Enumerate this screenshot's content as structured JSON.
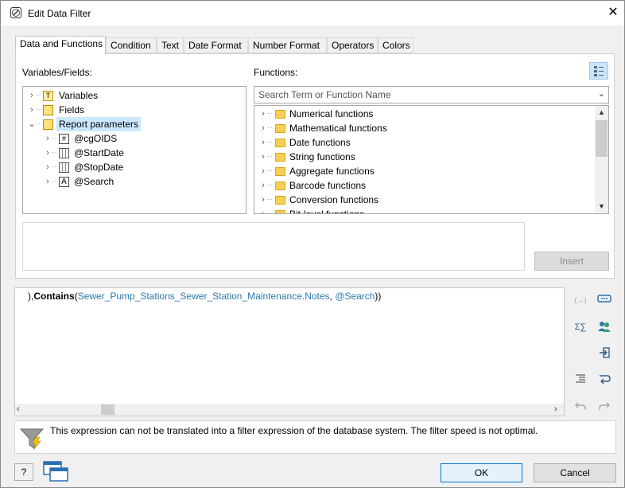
{
  "window": {
    "title": "Edit Data Filter",
    "close_glyph": "✕"
  },
  "tabs": [
    "Data and Functions",
    "Condition",
    "Text",
    "Date Format",
    "Number Format",
    "Operators",
    "Colors"
  ],
  "active_tab": "Data and Functions",
  "variables_panel": {
    "label": "Variables/Fields:",
    "tree": [
      {
        "label": "Variables",
        "icon": "variable-icon",
        "level": 0,
        "expanded": false
      },
      {
        "label": "Fields",
        "icon": "field-icon",
        "level": 0,
        "expanded": false
      },
      {
        "label": "Report parameters",
        "icon": "parameters-icon",
        "level": 0,
        "expanded": true,
        "selected": true
      },
      {
        "label": "@cgOIDS",
        "icon": "number-icon",
        "level": 1
      },
      {
        "label": "@StartDate",
        "icon": "date-icon",
        "level": 1
      },
      {
        "label": "@StopDate",
        "icon": "date-icon",
        "level": 1
      },
      {
        "label": "@Search",
        "icon": "text-icon",
        "level": 1
      }
    ]
  },
  "functions_panel": {
    "label": "Functions:",
    "search_placeholder": "Search Term or Function Name",
    "items": [
      "Numerical functions",
      "Mathematical functions",
      "Date functions",
      "String functions",
      "Aggregate functions",
      "Barcode functions",
      "Conversion functions",
      "Bit-level functions"
    ]
  },
  "insert_button": "Insert",
  "expression": {
    "prefix": "),",
    "function": "Contains",
    "open": "(",
    "field": "Sewer_Pump_Stations_Sewer_Station_Maintenance.Notes",
    "sep": ", ",
    "param": "@Search",
    "close": "))"
  },
  "hint": "This expression can not be translated into a filter expression of the database system. The filter speed is not optimal.",
  "buttons": {
    "ok": "OK",
    "cancel": "Cancel",
    "help_glyph": "?"
  },
  "side_tools": {
    "paren_glyph": "(↔)",
    "sum_glyph": "Σ∑"
  },
  "colors": {
    "selection": "#cce8ff",
    "field_text": "#2a7ab0",
    "folder": "#f7cf56"
  }
}
